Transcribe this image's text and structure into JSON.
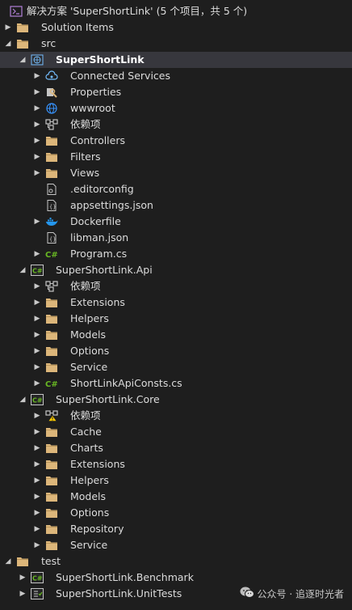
{
  "solution": {
    "title": "解决方案 'SuperShortLink' (5 个项目，共 5 个)"
  },
  "tree": [
    {
      "depth": 0,
      "arrow": "none",
      "icon": "solution-icon",
      "label": "解决方案 'SuperShortLink' (5 个项目，共 5 个)",
      "name": "solution-root"
    },
    {
      "depth": 0,
      "arrow": "collapsed",
      "icon": "folder-icon",
      "label": "Solution Items",
      "name": "folder-solution-items"
    },
    {
      "depth": 0,
      "arrow": "expanded",
      "icon": "folder-icon",
      "label": "src",
      "name": "folder-src"
    },
    {
      "depth": 1,
      "arrow": "expanded",
      "icon": "web-project-icon",
      "label": "SuperShortLink",
      "name": "project-supershortlink",
      "selected": true
    },
    {
      "depth": 2,
      "arrow": "collapsed",
      "icon": "connected-services-icon",
      "label": "Connected Services",
      "name": "node-connected-services"
    },
    {
      "depth": 2,
      "arrow": "collapsed",
      "icon": "properties-icon",
      "label": "Properties",
      "name": "node-properties"
    },
    {
      "depth": 2,
      "arrow": "collapsed",
      "icon": "globe-icon",
      "label": "wwwroot",
      "name": "node-wwwroot"
    },
    {
      "depth": 2,
      "arrow": "collapsed",
      "icon": "dependencies-icon",
      "label": "依赖项",
      "name": "node-dependencies"
    },
    {
      "depth": 2,
      "arrow": "collapsed",
      "icon": "folder-icon",
      "label": "Controllers",
      "name": "folder-controllers"
    },
    {
      "depth": 2,
      "arrow": "collapsed",
      "icon": "folder-icon",
      "label": "Filters",
      "name": "folder-filters"
    },
    {
      "depth": 2,
      "arrow": "collapsed",
      "icon": "folder-icon",
      "label": "Views",
      "name": "folder-views"
    },
    {
      "depth": 2,
      "arrow": "none",
      "icon": "config-file-icon",
      "label": ".editorconfig",
      "name": "file-editorconfig"
    },
    {
      "depth": 2,
      "arrow": "none",
      "icon": "json-file-icon",
      "label": "appsettings.json",
      "name": "file-appsettings-json"
    },
    {
      "depth": 2,
      "arrow": "collapsed",
      "icon": "docker-icon",
      "label": "Dockerfile",
      "name": "file-dockerfile"
    },
    {
      "depth": 2,
      "arrow": "none",
      "icon": "json-file-icon",
      "label": "libman.json",
      "name": "file-libman-json"
    },
    {
      "depth": 2,
      "arrow": "collapsed",
      "icon": "csharp-file-icon",
      "label": "Program.cs",
      "name": "file-program-cs"
    },
    {
      "depth": 1,
      "arrow": "expanded",
      "icon": "csharp-project-icon",
      "label": "SuperShortLink.Api",
      "name": "project-supershortlink-api"
    },
    {
      "depth": 2,
      "arrow": "collapsed",
      "icon": "dependencies-icon",
      "label": "依赖项",
      "name": "node-dependencies"
    },
    {
      "depth": 2,
      "arrow": "collapsed",
      "icon": "folder-icon",
      "label": "Extensions",
      "name": "folder-extensions"
    },
    {
      "depth": 2,
      "arrow": "collapsed",
      "icon": "folder-icon",
      "label": "Helpers",
      "name": "folder-helpers"
    },
    {
      "depth": 2,
      "arrow": "collapsed",
      "icon": "folder-icon",
      "label": "Models",
      "name": "folder-models"
    },
    {
      "depth": 2,
      "arrow": "collapsed",
      "icon": "folder-icon",
      "label": "Options",
      "name": "folder-options"
    },
    {
      "depth": 2,
      "arrow": "collapsed",
      "icon": "folder-icon",
      "label": "Service",
      "name": "folder-service"
    },
    {
      "depth": 2,
      "arrow": "collapsed",
      "icon": "csharp-file-icon",
      "label": "ShortLinkApiConsts.cs",
      "name": "file-shortlinkapiconsts-cs"
    },
    {
      "depth": 1,
      "arrow": "expanded",
      "icon": "csharp-project-icon",
      "label": "SuperShortLink.Core",
      "name": "project-supershortlink-core"
    },
    {
      "depth": 2,
      "arrow": "collapsed",
      "icon": "dependencies-warning-icon",
      "label": "依赖项",
      "name": "node-dependencies-warning"
    },
    {
      "depth": 2,
      "arrow": "collapsed",
      "icon": "folder-icon",
      "label": "Cache",
      "name": "folder-cache"
    },
    {
      "depth": 2,
      "arrow": "collapsed",
      "icon": "folder-icon",
      "label": "Charts",
      "name": "folder-charts"
    },
    {
      "depth": 2,
      "arrow": "collapsed",
      "icon": "folder-icon",
      "label": "Extensions",
      "name": "folder-extensions"
    },
    {
      "depth": 2,
      "arrow": "collapsed",
      "icon": "folder-icon",
      "label": "Helpers",
      "name": "folder-helpers"
    },
    {
      "depth": 2,
      "arrow": "collapsed",
      "icon": "folder-icon",
      "label": "Models",
      "name": "folder-models"
    },
    {
      "depth": 2,
      "arrow": "collapsed",
      "icon": "folder-icon",
      "label": "Options",
      "name": "folder-options"
    },
    {
      "depth": 2,
      "arrow": "collapsed",
      "icon": "folder-icon",
      "label": "Repository",
      "name": "folder-repository"
    },
    {
      "depth": 2,
      "arrow": "collapsed",
      "icon": "folder-icon",
      "label": "Service",
      "name": "folder-service"
    },
    {
      "depth": 0,
      "arrow": "expanded",
      "icon": "folder-icon",
      "label": "test",
      "name": "folder-test"
    },
    {
      "depth": 1,
      "arrow": "collapsed",
      "icon": "csharp-project-icon",
      "label": "SuperShortLink.Benchmark",
      "name": "project-supershortlink-benchmark"
    },
    {
      "depth": 1,
      "arrow": "collapsed",
      "icon": "test-project-icon",
      "label": "SuperShortLink.UnitTests",
      "name": "project-supershortlink-unittests"
    }
  ],
  "watermark": {
    "text": "公众号 · 追逐时光者",
    "icon": "wechat-icon"
  },
  "colors": {
    "background": "#1e1e1e",
    "selected_row": "#37373d",
    "folder": "#dcb67a",
    "csharp": "#68b723",
    "text": "#dcdcdc"
  }
}
